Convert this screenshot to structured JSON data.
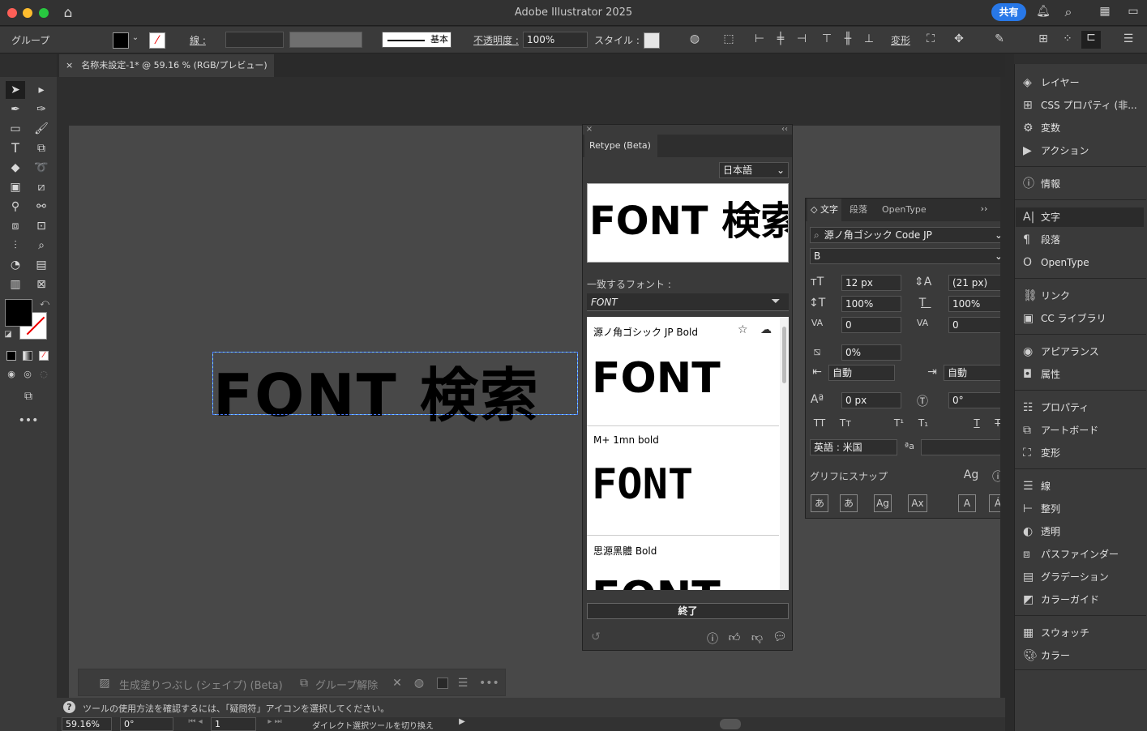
{
  "app": {
    "title": "Adobe Illustrator 2025",
    "share": "共有"
  },
  "control": {
    "group": "グループ",
    "stroke": "線 :",
    "stroke_style": "基本",
    "opacity_label": "不透明度 :",
    "opacity": "100%",
    "style": "スタイル :",
    "transform": "変形"
  },
  "doc": {
    "tab": "名称未設定-1* @ 59.16 % (RGB/プレビュー)",
    "canvas_text": "FONT 検索"
  },
  "retype": {
    "tab": "Retype (Beta)",
    "lang": "日本語",
    "preview": "FONT 検索",
    "match_label": "一致するフォント :",
    "filter_text": "FONT",
    "fonts": [
      {
        "name": "源ノ角ゴシック JP Bold",
        "sample": "FONT"
      },
      {
        "name": "M+ 1mn bold",
        "sample": "FONT"
      },
      {
        "name": "思源黑體 Bold",
        "sample": "FONT"
      }
    ],
    "done": "終了"
  },
  "character": {
    "tabs": [
      "文字",
      "段落",
      "OpenType"
    ],
    "font": "源ノ角ゴシック Code JP",
    "style": "B",
    "size": "12 px",
    "leading": "(21 px)",
    "vscale": "100%",
    "hscale": "100%",
    "kerning": "0",
    "tracking": "0",
    "tsume": "0%",
    "aki_l": "自動",
    "aki_r": "自動",
    "baseline": "0 px",
    "rotation": "0°",
    "lang": "英語 : 米国",
    "snap": "グリフにスナップ"
  },
  "panels": {
    "items": [
      "レイヤー",
      "CSS プロパティ (非...",
      "変数",
      "アクション",
      "情報",
      "文字",
      "段落",
      "OpenType",
      "リンク",
      "CC ライブラリ",
      "アピアランス",
      "属性",
      "プロパティ",
      "アートボード",
      "変形",
      "線",
      "整列",
      "透明",
      "パスファインダー",
      "グラデーション",
      "カラーガイド",
      "スウォッチ",
      "カラー"
    ]
  },
  "contextbar": {
    "gen": "生成塗りつぶし (シェイプ) (Beta)",
    "ungroup": "グループ解除"
  },
  "status": {
    "hint": "ツールの使用方法を確認するには、「疑問符」アイコンを選択してください。",
    "zoom": "59.16%",
    "angle": "0°",
    "page": "1",
    "tool": "ダイレクト選択ツールを切り換え"
  }
}
